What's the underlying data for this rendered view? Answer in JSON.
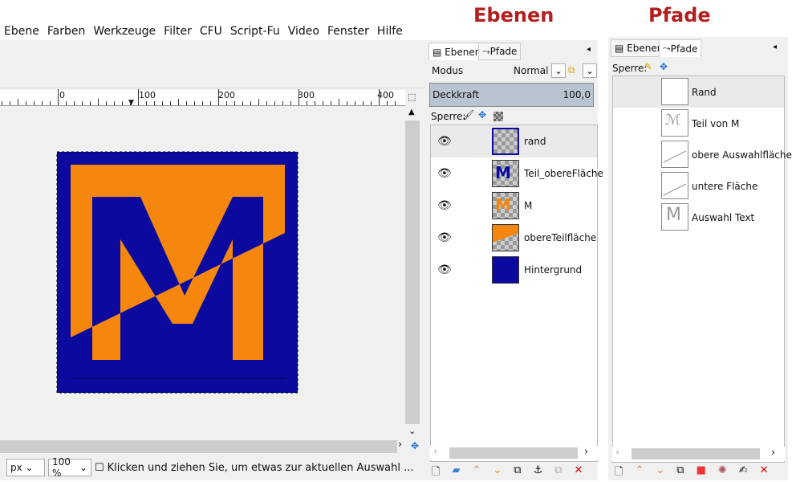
{
  "menu": [
    "Ebene",
    "Farben",
    "Werkzeuge",
    "Filter",
    "CFU",
    "Script-Fu",
    "Video",
    "Fenster",
    "Hilfe"
  ],
  "ruler": {
    "labels": [
      "0",
      "100",
      "200",
      "300",
      "400"
    ]
  },
  "status": {
    "unit": "px",
    "zoom": "100 %",
    "message": "Klicken und ziehen Sie, um etwas zur aktuellen Auswahl ..."
  },
  "captions": {
    "layers": "Ebenen",
    "paths": "Pfade"
  },
  "layers_panel": {
    "tabs": [
      "Ebenen",
      "Pfade"
    ],
    "mode_label": "Modus",
    "mode_value": "Normal",
    "opacity_label": "Deckkraft",
    "opacity_value": "100,0",
    "lock_label": "Sperre:",
    "layers": [
      {
        "name": "rand",
        "visible": true
      },
      {
        "name": "Teil_obereFläche",
        "visible": true
      },
      {
        "name": "M",
        "visible": true
      },
      {
        "name": "obereTeilfläche",
        "visible": true
      },
      {
        "name": "Hintergrund",
        "visible": true
      }
    ]
  },
  "paths_panel": {
    "tabs": [
      "Ebenen",
      "Pfade"
    ],
    "lock_label": "Sperre:",
    "paths": [
      "Rand",
      "Teil von M",
      "obere Auswahlfläche",
      "untere Fläche",
      "Auswahl Text"
    ]
  },
  "colors": {
    "blue": "#0c0a9e",
    "orange": "#f5870e",
    "title": "#b21f1f"
  }
}
